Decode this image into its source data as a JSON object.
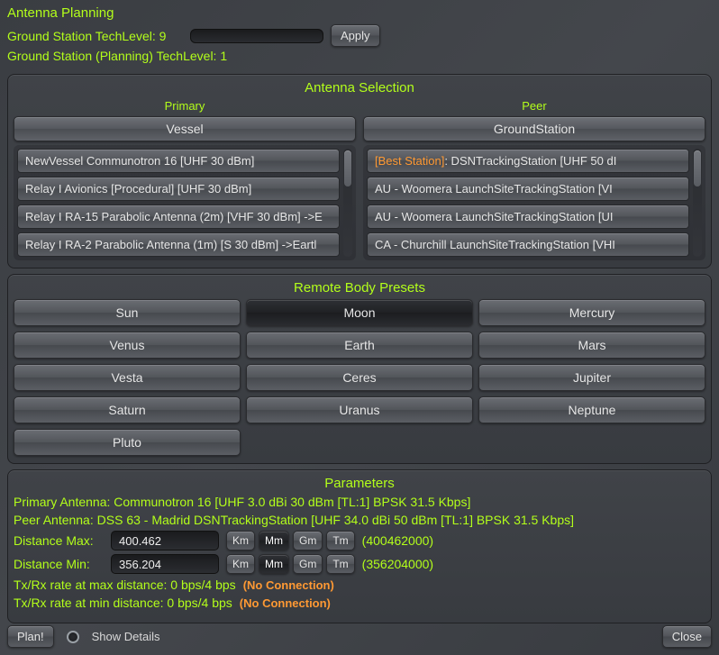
{
  "header": {
    "title": "Antenna Planning",
    "tech_level_label": "Ground Station TechLevel:",
    "tech_level_value": "9",
    "planning_tech_level_label": "Ground Station (Planning) TechLevel:",
    "planning_tech_level_value": "1",
    "input_value": "",
    "apply_label": "Apply"
  },
  "selection": {
    "title": "Antenna Selection",
    "primary_label": "Primary",
    "peer_label": "Peer",
    "primary_header": "Vessel",
    "peer_header": "GroundStation",
    "primary_items": [
      "NewVessel Communotron 16 [UHF 30 dBm]",
      "Relay I Avionics [Procedural] [UHF 30 dBm]",
      "Relay I RA-15 Parabolic Antenna (2m) [VHF 30 dBm]  ->E",
      "Relay I RA-2 Parabolic Antenna (1m) [S 30 dBm]  ->Eartl"
    ],
    "peer_best_prefix": "[Best Station]",
    "peer_best_suffix": ": DSNTrackingStation [UHF 50 dI",
    "peer_items": [
      "AU - Woomera LaunchSiteTrackingStation [VI",
      "AU - Woomera LaunchSiteTrackingStation [UI",
      "CA - Churchill LaunchSiteTrackingStation [VHI"
    ]
  },
  "presets": {
    "title": "Remote Body Presets",
    "items": [
      {
        "label": "Sun",
        "selected": false
      },
      {
        "label": "Moon",
        "selected": true
      },
      {
        "label": "Mercury",
        "selected": false
      },
      {
        "label": "Venus",
        "selected": false
      },
      {
        "label": "Earth",
        "selected": false
      },
      {
        "label": "Mars",
        "selected": false
      },
      {
        "label": "Vesta",
        "selected": false
      },
      {
        "label": "Ceres",
        "selected": false
      },
      {
        "label": "Jupiter",
        "selected": false
      },
      {
        "label": "Saturn",
        "selected": false
      },
      {
        "label": "Uranus",
        "selected": false
      },
      {
        "label": "Neptune",
        "selected": false
      },
      {
        "label": "Pluto",
        "selected": false
      }
    ]
  },
  "parameters": {
    "title": "Parameters",
    "primary_antenna_label": "Primary Antenna:  ",
    "primary_antenna_value": "Communotron 16 [UHF 3.0 dBi 30 dBm [TL:1] BPSK 31.5 Kbps]",
    "peer_antenna_label": "Peer Antenna: ",
    "peer_antenna_value": "DSS 63 - Madrid DSNTrackingStation [UHF 34.0 dBi 50 dBm [TL:1] BPSK 31.5 Kbps]",
    "dist_max_label": "Distance Max:",
    "dist_max_value": "400.462",
    "dist_max_raw": "(400462000)",
    "dist_min_label": "Distance Min:",
    "dist_min_value": "356.204",
    "dist_min_raw": "(356204000)",
    "units": {
      "km": "Km",
      "mm": "Mm",
      "gm": "Gm",
      "tm": "Tm"
    },
    "txrx_max_label": "Tx/Rx rate at max distance: ",
    "txrx_max_value": "0 bps/4 bps  ",
    "txrx_min_label": "Tx/Rx rate at min distance: ",
    "txrx_min_value": "0 bps/4 bps  ",
    "no_connection": "(No Connection)"
  },
  "footer": {
    "plan_label": "Plan!",
    "show_details_label": "Show Details",
    "close_label": "Close"
  }
}
